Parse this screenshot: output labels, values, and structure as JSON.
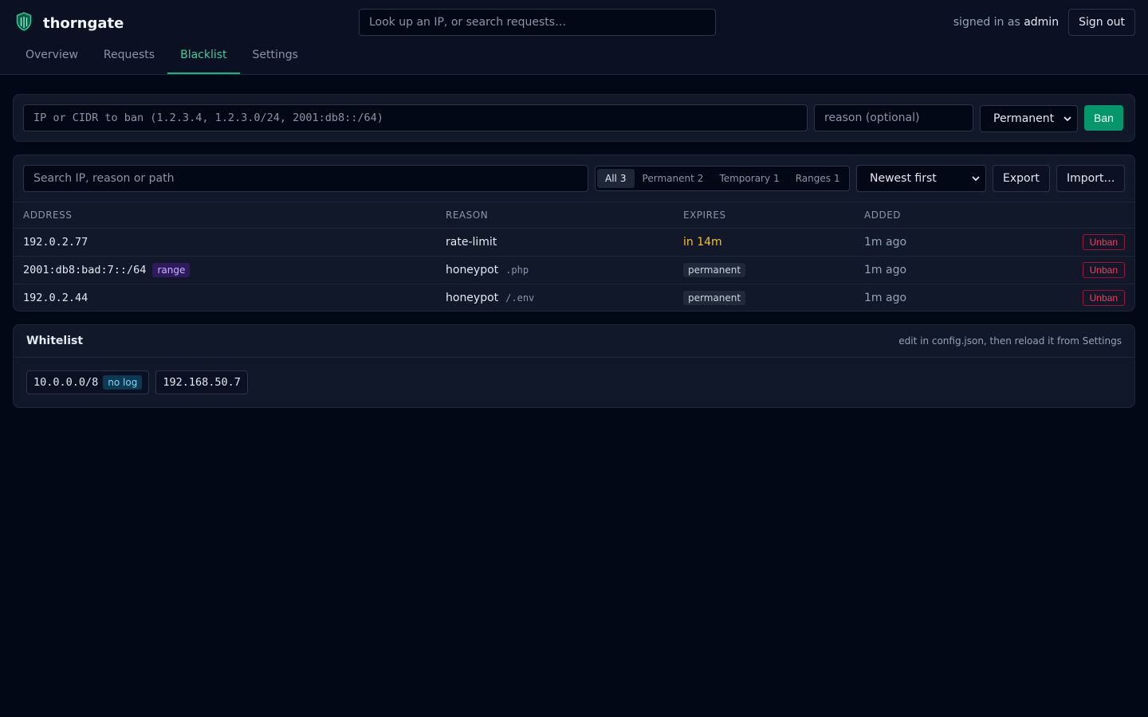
{
  "app": {
    "name": "thorngate",
    "accent": "#10b981",
    "logo_icon": "shield-icon"
  },
  "header": {
    "search_placeholder": "Look up an IP, or search requests…",
    "signed_in_prefix": "signed in as",
    "username": "admin",
    "sign_out_label": "Sign out"
  },
  "tabs": [
    {
      "label": "Overview",
      "active": false
    },
    {
      "label": "Requests",
      "active": false
    },
    {
      "label": "Blacklist",
      "active": true
    },
    {
      "label": "Settings",
      "active": false
    }
  ],
  "ban_form": {
    "ip_placeholder": "IP or CIDR to ban (1.2.3.4, 1.2.3.0/24, 2001:db8::/64)",
    "reason_placeholder": "reason (optional)",
    "duration_selected": "Permanent",
    "ban_label": "Ban"
  },
  "blacklist": {
    "search_placeholder": "Search IP, reason or path",
    "filters": [
      {
        "label": "All",
        "count": "3",
        "active": true
      },
      {
        "label": "Permanent",
        "count": "2",
        "active": false
      },
      {
        "label": "Temporary",
        "count": "1",
        "active": false
      },
      {
        "label": "Ranges",
        "count": "1",
        "active": false
      }
    ],
    "sort_selected": "Newest first",
    "export_label": "Export",
    "import_label": "Import…",
    "columns": {
      "address": "Address",
      "reason": "Reason",
      "expires": "Expires",
      "added": "Added"
    },
    "rows": [
      {
        "address": "192.0.2.77",
        "range_badge": "",
        "reason": "rate-limit",
        "path": "",
        "expires": "in 14m",
        "expires_kind": "temporary",
        "added": "1m ago",
        "action": "Unban"
      },
      {
        "address": "2001:db8:bad:7::/64",
        "range_badge": "range",
        "reason": "honeypot",
        "path": ".php",
        "expires": "permanent",
        "expires_kind": "permanent",
        "added": "1m ago",
        "action": "Unban"
      },
      {
        "address": "192.0.2.44",
        "range_badge": "",
        "reason": "honeypot",
        "path": "/.env",
        "expires": "permanent",
        "expires_kind": "permanent",
        "added": "1m ago",
        "action": "Unban"
      }
    ]
  },
  "whitelist": {
    "title": "Whitelist",
    "hint": "edit in config.json, then reload it from Settings",
    "entries": [
      {
        "address": "10.0.0.0/8",
        "badge": "no log"
      },
      {
        "address": "192.168.50.7",
        "badge": ""
      }
    ]
  }
}
